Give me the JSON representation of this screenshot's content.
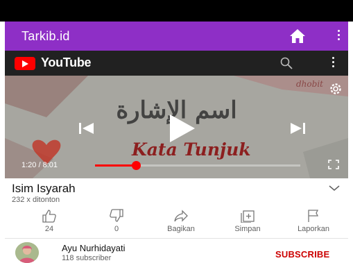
{
  "app": {
    "title": "Tarkib.id"
  },
  "youtube": {
    "brand": "YouTube"
  },
  "video": {
    "title_arabic": "اسم الإشارة",
    "title_overlay": "Kata Tunjuk",
    "watermark": "dhobit",
    "time_display": "1:20 / 8:01",
    "progress_fraction": 0.2
  },
  "details": {
    "title": "Isim Isyarah",
    "views": "232 x ditonton"
  },
  "actions": [
    {
      "icon": "thumb-up-icon",
      "label": "24"
    },
    {
      "icon": "thumb-down-icon",
      "label": "0"
    },
    {
      "icon": "share-icon",
      "label": "Bagikan"
    },
    {
      "icon": "save-icon",
      "label": "Simpan"
    },
    {
      "icon": "flag-icon",
      "label": "Laporkan"
    }
  ],
  "channel": {
    "name": "Ayu Nurhidayati",
    "subscribers": "118 subscriber",
    "subscribe_label": "SUBSCRIBE"
  },
  "colors": {
    "appbar": "#8e2fc6",
    "youtube_red": "#ff0000",
    "subscribe": "#cc0000"
  }
}
